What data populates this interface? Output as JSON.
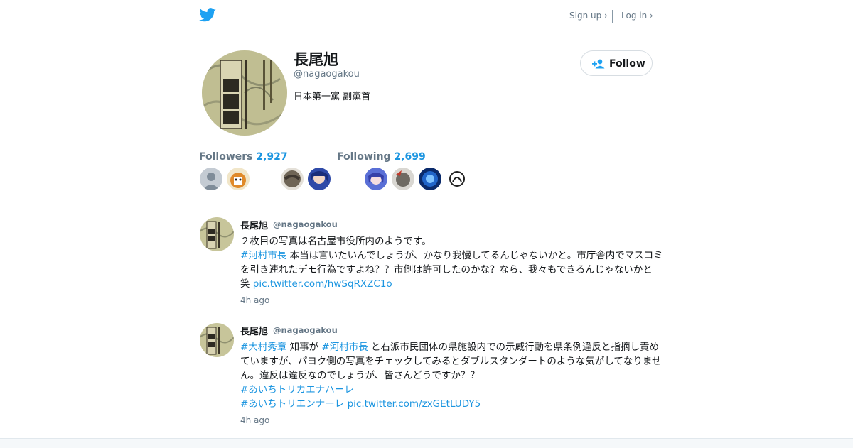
{
  "header": {
    "signup_label": "Sign up ›",
    "login_label": "Log in ›",
    "brand_color": "#1da1f2"
  },
  "profile": {
    "name": "長尾旭",
    "handle": "@nagaogakou",
    "bio": "日本第一黨 副黨首",
    "follow_label": "Follow",
    "followers_label": "Followers",
    "followers_count": "2,927",
    "following_label": "Following",
    "following_count": "2,699"
  },
  "tweets": [
    {
      "name": "長尾旭",
      "handle": "@nagaogakou",
      "line1": "２枚目の写真は名古屋市役所内のようです。",
      "tag1": "#河村市長",
      "text1": " 本当は言いたいんでしょうが、かなり我慢してるんじゃないかと。市庁舎内でマスコミを引き連れたデモ行為ですよね？？市側は許可したのかな？なら、我々もできるんじゃないかと 笑 ",
      "link": "pic.twitter.com/hwSqRXZC1o",
      "time": "4h ago"
    },
    {
      "name": "長尾旭",
      "handle": "@nagaogakou",
      "tag1": "#大村秀章",
      "text1": " 知事が ",
      "tag2": "#河村市長",
      "text2": " と右派市民団体の県施設内での示威行動を県条例違反と指摘し責めていますが、パヨク側の写真をチェックしてみるとダブルスタンダートのような気がしてなりません。違反は違反なのでしょうが、皆さんどうですか？？",
      "tag3": "#あいちトリカエナハーレ",
      "tag4": "#あいちトリエンナーレ",
      "link": "pic.twitter.com/zxGEtLUDY5",
      "time": "4h ago"
    }
  ]
}
